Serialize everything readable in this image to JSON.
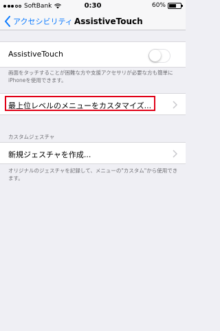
{
  "status_bar": {
    "carrier": "SoftBank",
    "time": "0:30",
    "battery_percent": "60%",
    "battery_level": 0.6
  },
  "nav": {
    "back_label": "アクセシビリティ",
    "title": "AssistiveTouch"
  },
  "assistive_touch": {
    "label": "AssistiveTouch",
    "enabled": false,
    "description": "画面をタッチすることが困難な方や支援アクセサリが必要な方も簡単にiPhoneを使用できます。"
  },
  "menu": {
    "customize_label": "最上位レベルのメニューをカスタマイズ..."
  },
  "custom_gestures": {
    "header": "カスタムジェスチャ",
    "create_label": "新規ジェスチャを作成...",
    "description": "オリジナルのジェスチャを記録して、メニューの\"カスタム\"から使用できます。"
  },
  "colors": {
    "accent": "#0a7aff",
    "highlight": "#e00016",
    "background": "#efeff4"
  }
}
